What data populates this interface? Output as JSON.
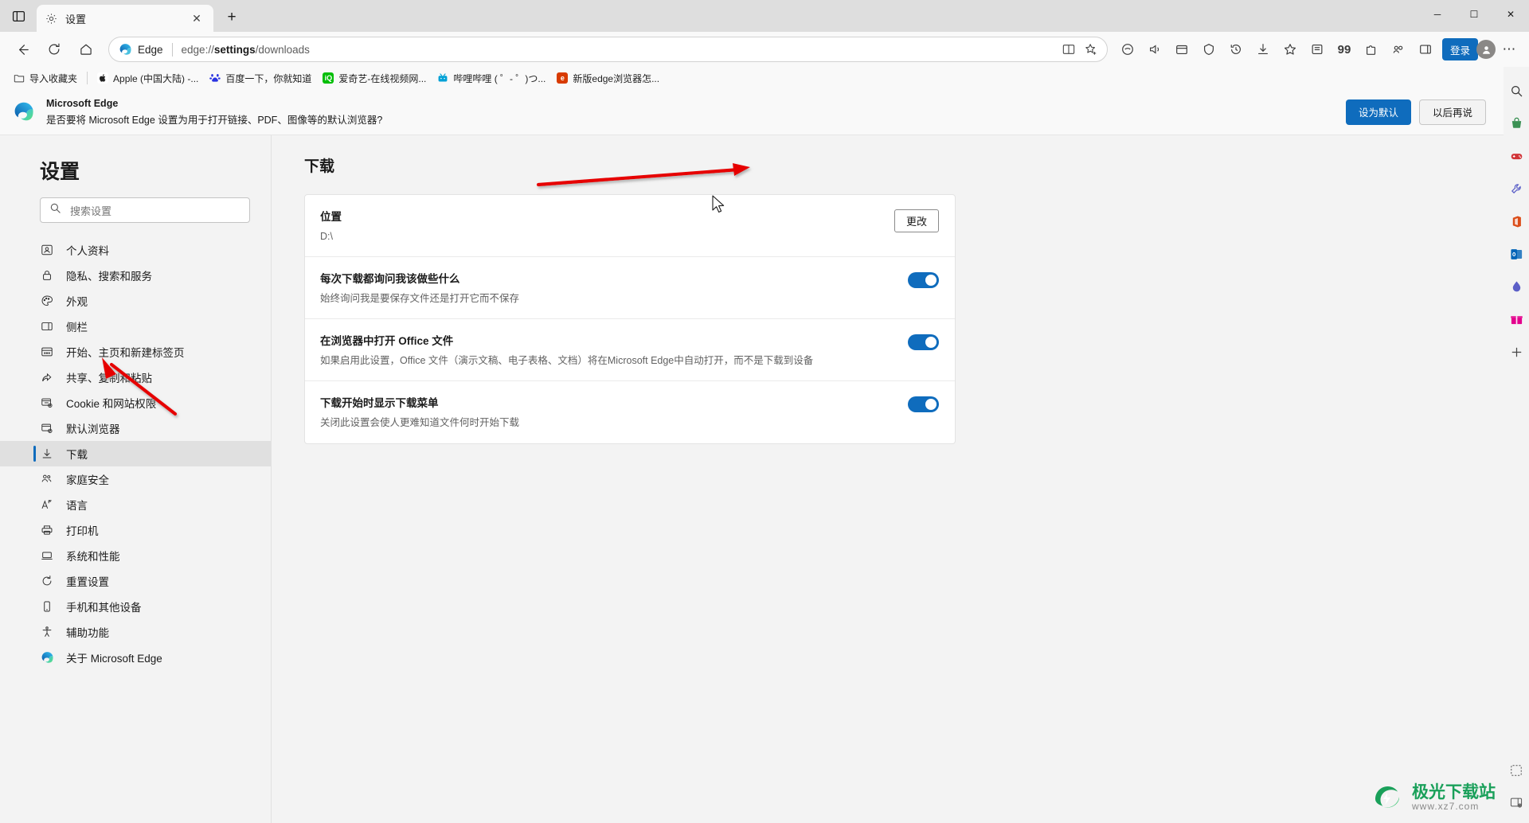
{
  "window": {
    "tab": {
      "title": "设置",
      "favicon": "gear-icon",
      "close": "✕"
    },
    "new_tab_label": "+",
    "controls": {
      "minimize": "─",
      "maximize": "☐",
      "close": "✕"
    }
  },
  "navbar": {
    "back": "←",
    "reload": "⟳",
    "home": "⌂",
    "edge_chip": "Edge",
    "url_prefix": "edge://",
    "url_bold": "settings",
    "url_suffix": "/downloads",
    "split_screen_icon": "split-screen-icon",
    "favorite_icon": "star-plus-icon",
    "icons": [
      "copilot-icon",
      "history-icon",
      "collections-icon",
      "browser-essentials-icon",
      "downloads-icon",
      "favorites-icon",
      "read-aloud-icon",
      "quote-icon",
      "extensions-icon",
      "workspaces-icon",
      "split-icon"
    ],
    "signin_label": "登录",
    "settings_more": "⋯"
  },
  "bookmarks": {
    "import_label": "导入收藏夹",
    "items": [
      {
        "label": "Apple (中国大陆) -...",
        "color": "#333333",
        "glyph": ""
      },
      {
        "label": "百度一下，你就知道",
        "color": "#2932e1",
        "glyph": "百"
      },
      {
        "label": "爱奇艺-在线视频网...",
        "color": "#00be06",
        "glyph": "iQ"
      },
      {
        "label": "哔哩哔哩 ( ゜- ゜)つ...",
        "color": "#00a1d6",
        "glyph": "b"
      },
      {
        "label": "新版edge浏览器怎...",
        "color": "#d83b01",
        "glyph": "e"
      }
    ]
  },
  "banner": {
    "title": "Microsoft Edge",
    "subtitle": "是否要将 Microsoft Edge 设置为用于打开链接、PDF、图像等的默认浏览器?",
    "primary_label": "设为默认",
    "secondary_label": "以后再说"
  },
  "sidebar": {
    "title": "设置",
    "search_placeholder": "搜索设置",
    "search_icon": "search-icon",
    "items": [
      {
        "label": "个人资料",
        "icon": "profile-icon",
        "selected": false
      },
      {
        "label": "隐私、搜索和服务",
        "icon": "lock-icon",
        "selected": false
      },
      {
        "label": "外观",
        "icon": "palette-icon",
        "selected": false
      },
      {
        "label": "侧栏",
        "icon": "sidebar-icon",
        "selected": false
      },
      {
        "label": "开始、主页和新建标签页",
        "icon": "home-page-icon",
        "selected": false
      },
      {
        "label": "共享、复制和粘贴",
        "icon": "share-icon",
        "selected": false
      },
      {
        "label": "Cookie 和网站权限",
        "icon": "cookie-icon",
        "selected": false
      },
      {
        "label": "默认浏览器",
        "icon": "default-browser-icon",
        "selected": false
      },
      {
        "label": "下载",
        "icon": "download-icon",
        "selected": true
      },
      {
        "label": "家庭安全",
        "icon": "family-icon",
        "selected": false
      },
      {
        "label": "语言",
        "icon": "language-icon",
        "selected": false
      },
      {
        "label": "打印机",
        "icon": "printer-icon",
        "selected": false
      },
      {
        "label": "系统和性能",
        "icon": "system-icon",
        "selected": false
      },
      {
        "label": "重置设置",
        "icon": "reset-icon",
        "selected": false
      },
      {
        "label": "手机和其他设备",
        "icon": "phone-icon",
        "selected": false
      },
      {
        "label": "辅助功能",
        "icon": "accessibility-icon",
        "selected": false
      },
      {
        "label": "关于 Microsoft Edge",
        "icon": "edge-logo-icon",
        "selected": false
      }
    ]
  },
  "main": {
    "page_title": "下载",
    "rows": [
      {
        "title": "位置",
        "sub": "D:\\",
        "control": "button",
        "button_label": "更改"
      },
      {
        "title": "每次下载都询问我该做些什么",
        "sub": "始终询问我是要保存文件还是打开它而不保存",
        "control": "toggle",
        "toggle_on": true
      },
      {
        "title": "在浏览器中打开 Office 文件",
        "sub": "如果启用此设置，Office 文件（演示文稿、电子表格、文档）将在Microsoft Edge中自动打开，而不是下载到设备",
        "control": "toggle",
        "toggle_on": true
      },
      {
        "title": "下载开始时显示下载菜单",
        "sub": "关闭此设置会使人更难知道文件何时开始下载",
        "control": "toggle",
        "toggle_on": true
      }
    ]
  },
  "edge_sidebar": {
    "icons": [
      "search-icon",
      "shopping-icon",
      "games-icon",
      "tools-icon",
      "office-icon",
      "outlook-icon",
      "drop-icon",
      "gift-icon",
      "add-icon"
    ],
    "bottom_icons": [
      "customize-icon",
      "sidebar-settings-icon"
    ]
  },
  "annotations": {
    "arrow_to_change_button": "red-arrow",
    "arrow_to_downloads_nav": "red-arrow",
    "cursor": "mouse-pointer"
  },
  "watermark": {
    "main": "极光下载站",
    "sub": "www.xz7.com"
  },
  "colors": {
    "accent": "#0f6cbd",
    "selected_nav": "#e0e0e0",
    "annotation": "#e60000"
  }
}
